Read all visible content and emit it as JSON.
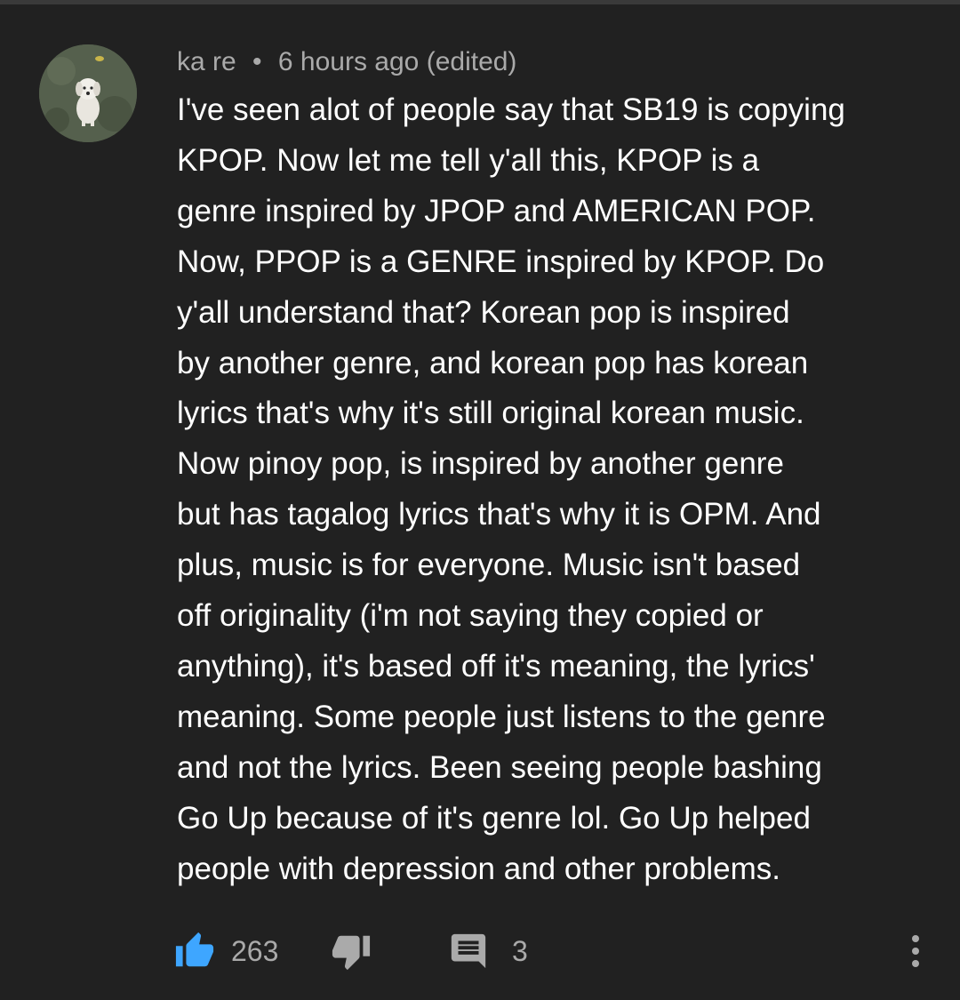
{
  "comment": {
    "author": "ka re",
    "separator": "•",
    "timestamp": "6 hours ago",
    "edited_label": "(edited)",
    "lines": [
      "I've seen alot of people say that SB19 is copying",
      "KPOP. Now let me tell y'all this, KPOP is a",
      "genre inspired by JPOP and AMERICAN POP.",
      "Now, PPOP is a GENRE inspired by KPOP. Do",
      "y'all understand that? Korean pop is inspired",
      "by another genre, and korean pop has korean",
      "lyrics that's why it's still original korean music.",
      "Now pinoy pop, is inspired by another genre",
      "but has tagalog lyrics that's why it is OPM. And",
      "plus, music is for everyone. Music isn't based",
      "off originality (i'm not saying they copied or",
      "anything), it's based off it's meaning, the lyrics'",
      "meaning. Some people just listens to the genre",
      "and not the lyrics. Been seeing people bashing",
      "Go Up because of it's genre lol. Go Up helped",
      "people with depression and other problems."
    ]
  },
  "actions": {
    "like_count": "263",
    "reply_count": "3"
  },
  "icons": {
    "like": "thumbs-up-icon",
    "dislike": "thumbs-down-icon",
    "reply": "comment-icon",
    "more": "more-vert-icon"
  },
  "colors": {
    "background": "#212121",
    "text_primary": "#ffffff",
    "text_secondary": "#aaaaaa",
    "like_active": "#3ea6ff"
  }
}
